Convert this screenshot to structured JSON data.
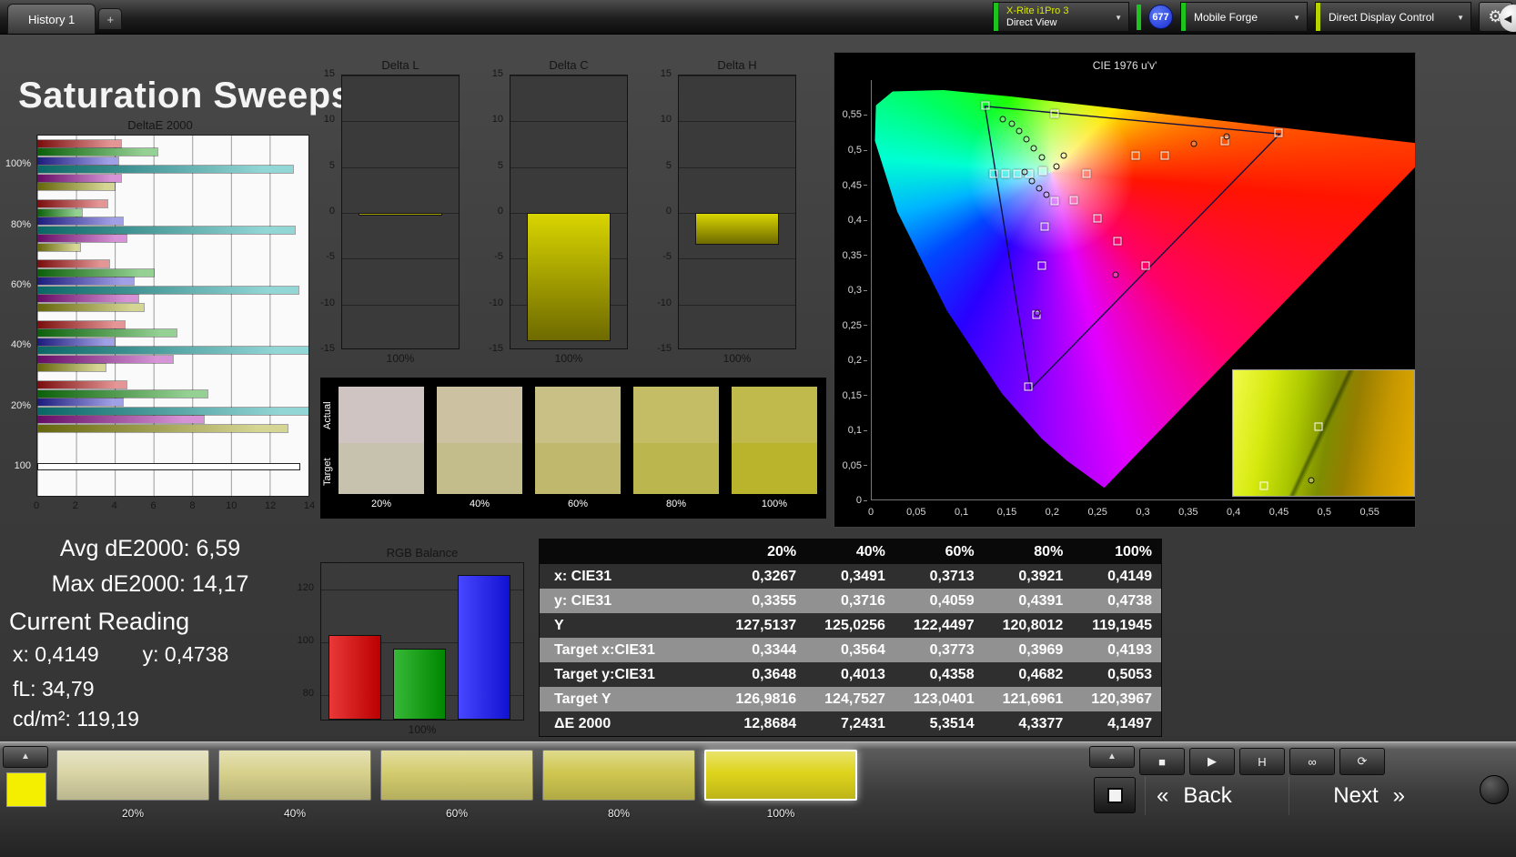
{
  "topbar": {
    "history_tab": "History 1",
    "add_tab": "+",
    "meter_line1": "X-Rite i1Pro 3",
    "meter_line2": "Direct View",
    "badge": "677",
    "source_dropdown": "Mobile Forge",
    "display_dropdown": "Direct Display Control",
    "colors": {
      "meter_edge": "#1ec41e",
      "source_edge": "#1ec41e",
      "display_edge": "#b8d400",
      "badge_bg": "#1a2fd4"
    }
  },
  "page_title": "Saturation Sweeps",
  "deltae_chart": {
    "type": "bar",
    "title": "DeltaE 2000",
    "xmax": 14,
    "xticks": [
      "0",
      "2",
      "4",
      "6",
      "8",
      "10",
      "12",
      "14"
    ],
    "bar_colors": [
      "#c41414",
      "#12990f",
      "#2c2cc8",
      "#0fa3a3",
      "#a312a3",
      "#a3a312"
    ],
    "groups": [
      {
        "label": "100%",
        "values": [
          4.3,
          6.2,
          4.2,
          13.2,
          4.3,
          4.0
        ]
      },
      {
        "label": "80%",
        "values": [
          3.6,
          2.3,
          4.4,
          13.3,
          4.6,
          2.2
        ]
      },
      {
        "label": "60%",
        "values": [
          3.7,
          6.0,
          5.0,
          13.5,
          5.2,
          5.5
        ]
      },
      {
        "label": "40%",
        "values": [
          4.5,
          7.2,
          4.0,
          14.0,
          7.0,
          3.5
        ]
      },
      {
        "label": "20%",
        "values": [
          4.6,
          8.8,
          4.4,
          14.2,
          8.6,
          12.9
        ]
      },
      {
        "label": "100",
        "values": [
          13.6
        ],
        "colors": [
          "#ffffff"
        ]
      }
    ]
  },
  "delta_axis": {
    "ymin": -15,
    "ymax": 15,
    "yticks": [
      "15",
      "10",
      "5",
      "0",
      "-5",
      "-10",
      "-15"
    ],
    "bar_color_top": "#d9d500",
    "bar_color_bottom": "#6e6a00"
  },
  "delta_charts": [
    {
      "title": "Delta L",
      "value": -0.3,
      "xlabel": "100%"
    },
    {
      "title": "Delta C",
      "value": -14.0,
      "xlabel": "100%"
    },
    {
      "title": "Delta H",
      "value": -3.5,
      "xlabel": "100%"
    }
  ],
  "swatch_strip": {
    "row_labels": [
      "Actual",
      "Target"
    ],
    "columns": [
      {
        "label": "20%",
        "actual": "#cfc4c1",
        "target": "#c6c2ad"
      },
      {
        "label": "40%",
        "actual": "#ccc2a1",
        "target": "#c3bd8c"
      },
      {
        "label": "60%",
        "actual": "#c9c085",
        "target": "#c0b96d"
      },
      {
        "label": "80%",
        "actual": "#c5bc66",
        "target": "#bcb64e"
      },
      {
        "label": "100%",
        "actual": "#c0ba4c",
        "target": "#bab42c"
      }
    ]
  },
  "cie_chart": {
    "type": "scatter",
    "title": "CIE 1976 u'v'",
    "u_range": [
      0,
      0.6
    ],
    "v_range": [
      0,
      0.6
    ],
    "axis_tick_values": [
      0,
      0.05,
      0.1,
      0.15,
      0.2,
      0.25,
      0.3,
      0.35,
      0.4,
      0.45,
      0.5,
      0.55
    ],
    "axis_tick_labels": [
      "0",
      "0,05",
      "0,1",
      "0,15",
      "0,2",
      "0,25",
      "0,3",
      "0,35",
      "0,4",
      "0,45",
      "0,5",
      "0,55"
    ],
    "gamut_triangle": [
      [
        0.4507,
        0.5229
      ],
      [
        0.125,
        0.5625
      ],
      [
        0.1754,
        0.1579
      ]
    ],
    "spectral_locus": [
      [
        0.2568,
        0.0166
      ],
      [
        0.2161,
        0.0549
      ],
      [
        0.1877,
        0.0871
      ],
      [
        0.1441,
        0.151
      ],
      [
        0.0828,
        0.2708
      ],
      [
        0.0282,
        0.4117
      ],
      [
        0.0035,
        0.5131
      ],
      [
        0.0046,
        0.5638
      ],
      [
        0.0231,
        0.5837
      ],
      [
        0.0792,
        0.5857
      ],
      [
        0.1531,
        0.5766
      ],
      [
        0.2623,
        0.5604
      ],
      [
        0.4035,
        0.5393
      ],
      [
        0.5203,
        0.5219
      ],
      [
        0.6234,
        0.5065
      ]
    ],
    "white_point": [
      0.1978,
      0.4683
    ],
    "target_points": [
      [
        0.126,
        0.563
      ],
      [
        0.202,
        0.552
      ],
      [
        0.135,
        0.466
      ],
      [
        0.148,
        0.466
      ],
      [
        0.161,
        0.466
      ],
      [
        0.174,
        0.466
      ],
      [
        0.189,
        0.47
      ],
      [
        0.237,
        0.466
      ],
      [
        0.291,
        0.492
      ],
      [
        0.324,
        0.492
      ],
      [
        0.39,
        0.513
      ],
      [
        0.449,
        0.524
      ],
      [
        0.202,
        0.427
      ],
      [
        0.223,
        0.428
      ],
      [
        0.249,
        0.402
      ],
      [
        0.271,
        0.37
      ],
      [
        0.191,
        0.39
      ],
      [
        0.188,
        0.335
      ],
      [
        0.303,
        0.334
      ],
      [
        0.182,
        0.264
      ],
      [
        0.173,
        0.161
      ]
    ],
    "measured_points": [
      [
        0.145,
        0.544
      ],
      [
        0.155,
        0.537
      ],
      [
        0.163,
        0.527
      ],
      [
        0.171,
        0.515
      ],
      [
        0.179,
        0.503
      ],
      [
        0.188,
        0.49
      ],
      [
        0.169,
        0.468
      ],
      [
        0.177,
        0.456
      ],
      [
        0.185,
        0.445
      ],
      [
        0.193,
        0.436
      ],
      [
        0.204,
        0.477
      ],
      [
        0.212,
        0.492
      ],
      [
        0.356,
        0.509
      ],
      [
        0.392,
        0.519
      ],
      [
        0.269,
        0.322
      ],
      [
        0.183,
        0.267
      ]
    ],
    "inset": {
      "squares": [
        [
          47,
          45
        ],
        [
          17,
          92
        ]
      ],
      "dots": [
        [
          43,
          88
        ]
      ]
    }
  },
  "readings": {
    "avg": "Avg dE2000: 6,59",
    "max": "Max dE2000: 14,17",
    "current_title": "Current Reading",
    "x_label": "x: 0,4149",
    "y_label": "y: 0,4738",
    "fl": "fL: 34,79",
    "cdm2": "cd/m²: 119,19"
  },
  "rgb_chart": {
    "type": "bar",
    "title": "RGB Balance",
    "categories": [
      "Red",
      "Green",
      "Blue"
    ],
    "values": [
      102,
      97,
      125
    ],
    "colors": [
      "#e40000",
      "#00a400",
      "#1414ff"
    ],
    "ylim": [
      70,
      130
    ],
    "yticks": [
      "120",
      "100",
      "80"
    ],
    "xlabel": "100%"
  },
  "table": {
    "header": [
      "",
      "20%",
      "40%",
      "60%",
      "80%",
      "100%"
    ],
    "rows": [
      {
        "label": "x: CIE31",
        "values": [
          "0,3267",
          "0,3491",
          "0,3713",
          "0,3921",
          "0,4149"
        ]
      },
      {
        "label": "y: CIE31",
        "values": [
          "0,3355",
          "0,3716",
          "0,4059",
          "0,4391",
          "0,4738"
        ]
      },
      {
        "label": "Y",
        "values": [
          "127,5137",
          "125,0256",
          "122,4497",
          "120,8012",
          "119,1945"
        ]
      },
      {
        "label": "Target x:CIE31",
        "values": [
          "0,3344",
          "0,3564",
          "0,3773",
          "0,3969",
          "0,4193"
        ]
      },
      {
        "label": "Target y:CIE31",
        "values": [
          "0,3648",
          "0,4013",
          "0,4358",
          "0,4682",
          "0,5053"
        ]
      },
      {
        "label": "Target Y",
        "values": [
          "126,9816",
          "124,7527",
          "123,0401",
          "121,6961",
          "120,3967"
        ]
      },
      {
        "label": "ΔE 2000",
        "values": [
          "12,8684",
          "7,2431",
          "5,3514",
          "4,3377",
          "4,1497"
        ]
      }
    ]
  },
  "bottom_bar": {
    "up_arrow": "▲",
    "mini_swatch_color": "#f4ee00",
    "swatches": [
      {
        "label": "20%",
        "color": "#dad5a6"
      },
      {
        "label": "40%",
        "color": "#d7d18c"
      },
      {
        "label": "60%",
        "color": "#d3cc6e"
      },
      {
        "label": "80%",
        "color": "#cfc750"
      },
      {
        "label": "100%",
        "color": "#ded41c",
        "selected": true
      }
    ],
    "transport": [
      {
        "name": "stop",
        "glyph": "■"
      },
      {
        "name": "play",
        "glyph": "▶"
      },
      {
        "name": "pause",
        "glyph": "H"
      },
      {
        "name": "loop",
        "glyph": "∞"
      },
      {
        "name": "refresh",
        "glyph": "⟳"
      }
    ],
    "back_chev": "«",
    "back_label": "Back",
    "next_label": "Next",
    "next_chev": "»"
  },
  "icons": {
    "gear": "⚙",
    "collapse": "◀",
    "chevron_down": "▼"
  }
}
